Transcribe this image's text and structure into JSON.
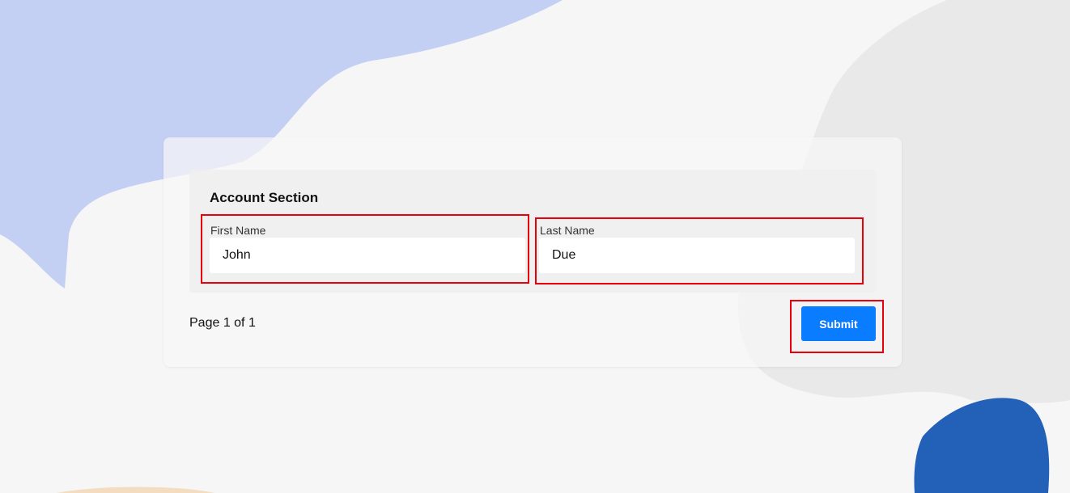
{
  "form": {
    "section_title": "Account Section",
    "first_name": {
      "label": "First Name",
      "value": "John"
    },
    "last_name": {
      "label": "Last Name",
      "value": "Due"
    },
    "page_indicator": "Page 1 of 1",
    "submit_label": "Submit"
  },
  "colors": {
    "accent": "#0a7cff",
    "highlight": "#e8000b",
    "blob_periwinkle": "#c4cff4",
    "blob_grey": "#e9e9e9",
    "blob_blue": "#2360b8",
    "blob_peach": "#f3dcc0"
  }
}
